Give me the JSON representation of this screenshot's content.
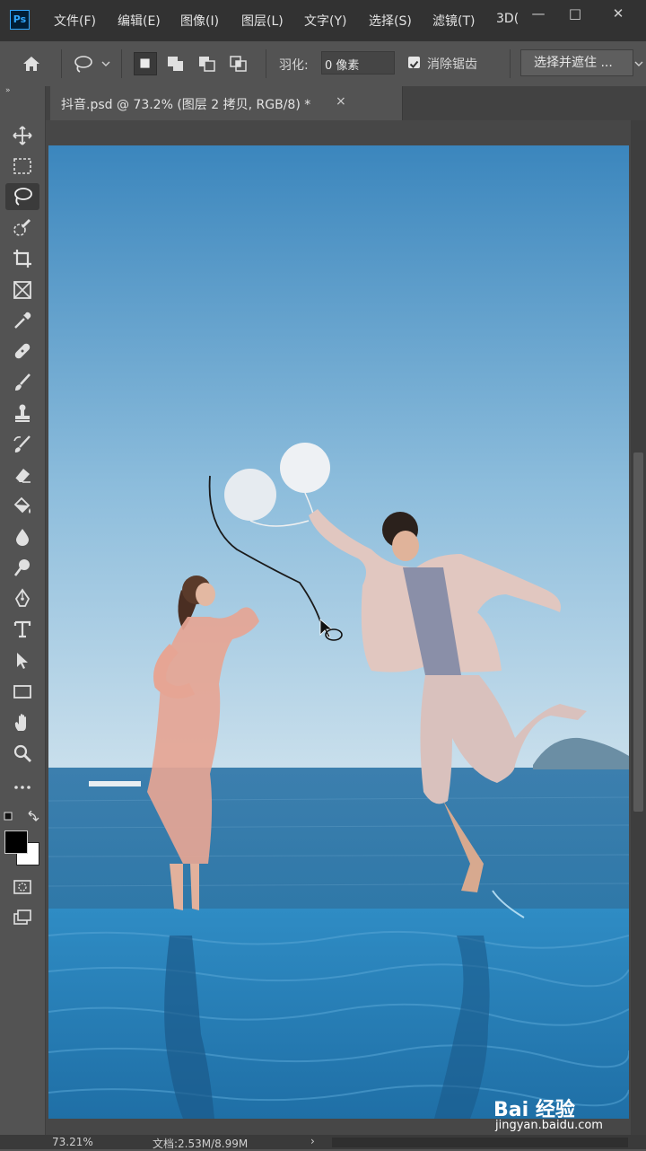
{
  "app": {
    "logo_text": "Ps"
  },
  "menu": {
    "items": [
      "文件(F)",
      "编辑(E)",
      "图像(I)",
      "图层(L)",
      "文字(Y)",
      "选择(S)",
      "滤镜(T)",
      "3D("
    ]
  },
  "window_controls": {
    "minimize": "—",
    "maximize": "□",
    "close": "✕"
  },
  "options": {
    "feather_label": "羽化:",
    "feather_value": "0 像素",
    "antialias_label": "消除锯齿",
    "antialias_checked": true,
    "select_mask_label": "选择并遮住 ..."
  },
  "toolbar": {
    "collapse": "»",
    "active_tool": "lasso-tool",
    "tools": [
      "move",
      "marquee",
      "lasso",
      "quick-select",
      "crop",
      "frame",
      "eyedropper",
      "healing",
      "brush",
      "clone-stamp",
      "history-brush",
      "eraser",
      "paint-bucket",
      "blur",
      "dodge",
      "pen",
      "type",
      "path-select",
      "rectangle",
      "hand",
      "zoom",
      "more"
    ],
    "foreground_color": "#000000",
    "background_color": "#ffffff"
  },
  "document": {
    "tab_title": "抖音.psd @ 73.2% (图层 2 拷贝, RGB/8) *",
    "close": "×"
  },
  "status": {
    "zoom": "73.21%",
    "doc_size": "文档:2.53M/8.99M",
    "arrow": "›"
  },
  "watermark": {
    "brand": "Bai 经验",
    "url": "jingyan.baidu.com"
  },
  "colors": {
    "menubar_bg": "#323232",
    "panel_bg": "#535353",
    "accent": "#31a8ff"
  }
}
